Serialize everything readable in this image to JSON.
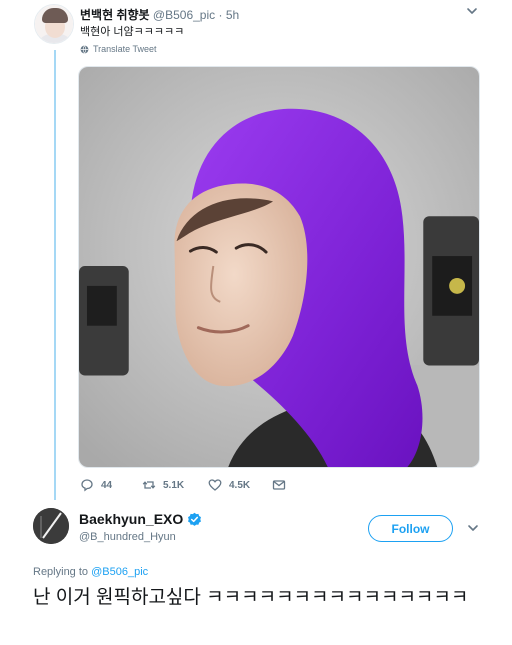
{
  "tweet1": {
    "display_name": "변백현 취향봇",
    "handle": "@B506_pic",
    "separator": "·",
    "time": "5h",
    "text": "백현아 너얌ㅋㅋㅋㅋㅋ",
    "translate_label": "Translate Tweet",
    "stats": {
      "replies": "44",
      "retweets": "5.1K",
      "likes": "4.5K"
    },
    "icons": [
      "chevron-down-icon",
      "globe-icon",
      "reply-icon",
      "retweet-icon",
      "like-icon",
      "message-icon"
    ]
  },
  "reply": {
    "display_name": "Baekhyun_EXO",
    "handle": "@B_hundred_Hyun",
    "follow_label": "Follow",
    "replying_prefix": "Replying to",
    "replying_to": "@B506_pic",
    "text": "난 이거 원픽하고싶다 ㅋㅋㅋㅋㅋㅋㅋㅋㅋㅋㅋㅋㅋㅋㅋ",
    "icons": [
      "verified-badge-icon",
      "chevron-down-icon"
    ]
  },
  "colors": {
    "accent": "#1da1f2",
    "thread_line": "#a5d8f5",
    "secondary_text": "#657786",
    "hood_purple": "#8a2be2"
  }
}
